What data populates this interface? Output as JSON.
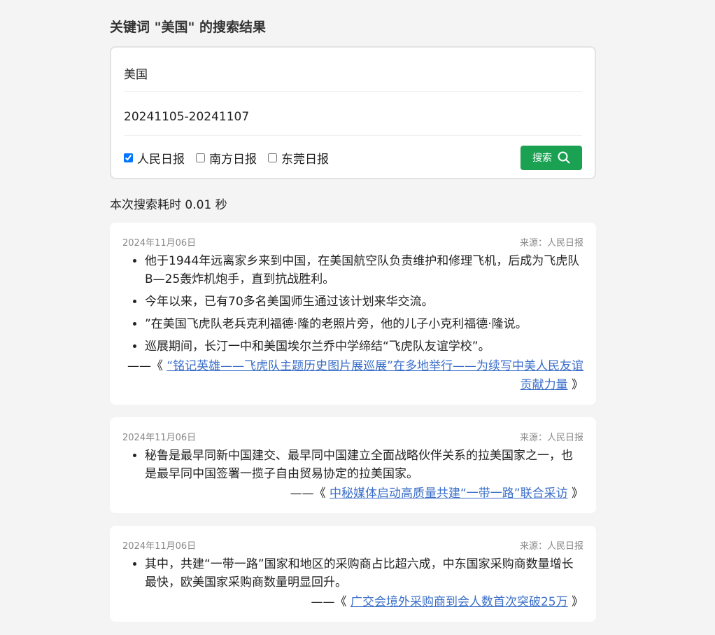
{
  "page_title": "关键词 \"美国\" 的搜索结果",
  "search": {
    "keyword": "美国",
    "date_range": "20241105-20241107",
    "sources": [
      {
        "label": "人民日报",
        "checked": true
      },
      {
        "label": "南方日报",
        "checked": false
      },
      {
        "label": "东莞日报",
        "checked": false
      }
    ],
    "button_label": "搜索"
  },
  "timing_text": "本次搜索耗时 0.01 秒",
  "results": [
    {
      "date": "2024年11月06日",
      "source": "来源：人民日报",
      "bullets": [
        "他于1944年远离家乡来到中国，在美国航空队负责维护和修理飞机，后成为飞虎队B—25轰炸机炮手，直到抗战胜利。",
        "今年以来，已有70多名美国师生通过该计划来华交流。",
        "”在美国飞虎队老兵克利福德·隆的老照片旁，他的儿子小克利福德·隆说。",
        "巡展期间，长汀一中和美国埃尔兰乔中学缔结“飞虎队友谊学校”。"
      ],
      "ref_prefix": "——《",
      "ref_title": "“铭记英雄——飞虎队主题历史图片展巡展”在多地举行——为续写中美人民友谊贡献力量",
      "ref_suffix": "》"
    },
    {
      "date": "2024年11月06日",
      "source": "来源：人民日报",
      "bullets": [
        "秘鲁是最早同新中国建交、最早同中国建立全面战略伙伴关系的拉美国家之一，也是最早同中国签署一揽子自由贸易协定的拉美国家。"
      ],
      "ref_prefix": "——《",
      "ref_title": "中秘媒体启动高质量共建“一带一路”联合采访",
      "ref_suffix": "》"
    },
    {
      "date": "2024年11月06日",
      "source": "来源：人民日报",
      "bullets": [
        "其中，共建“一带一路”国家和地区的采购商占比超六成，中东国家采购商数量增长最快，欧美国家采购商数量明显回升。"
      ],
      "ref_prefix": "——《",
      "ref_title": "广交会境外采购商到会人数首次突破25万",
      "ref_suffix": "》"
    }
  ]
}
